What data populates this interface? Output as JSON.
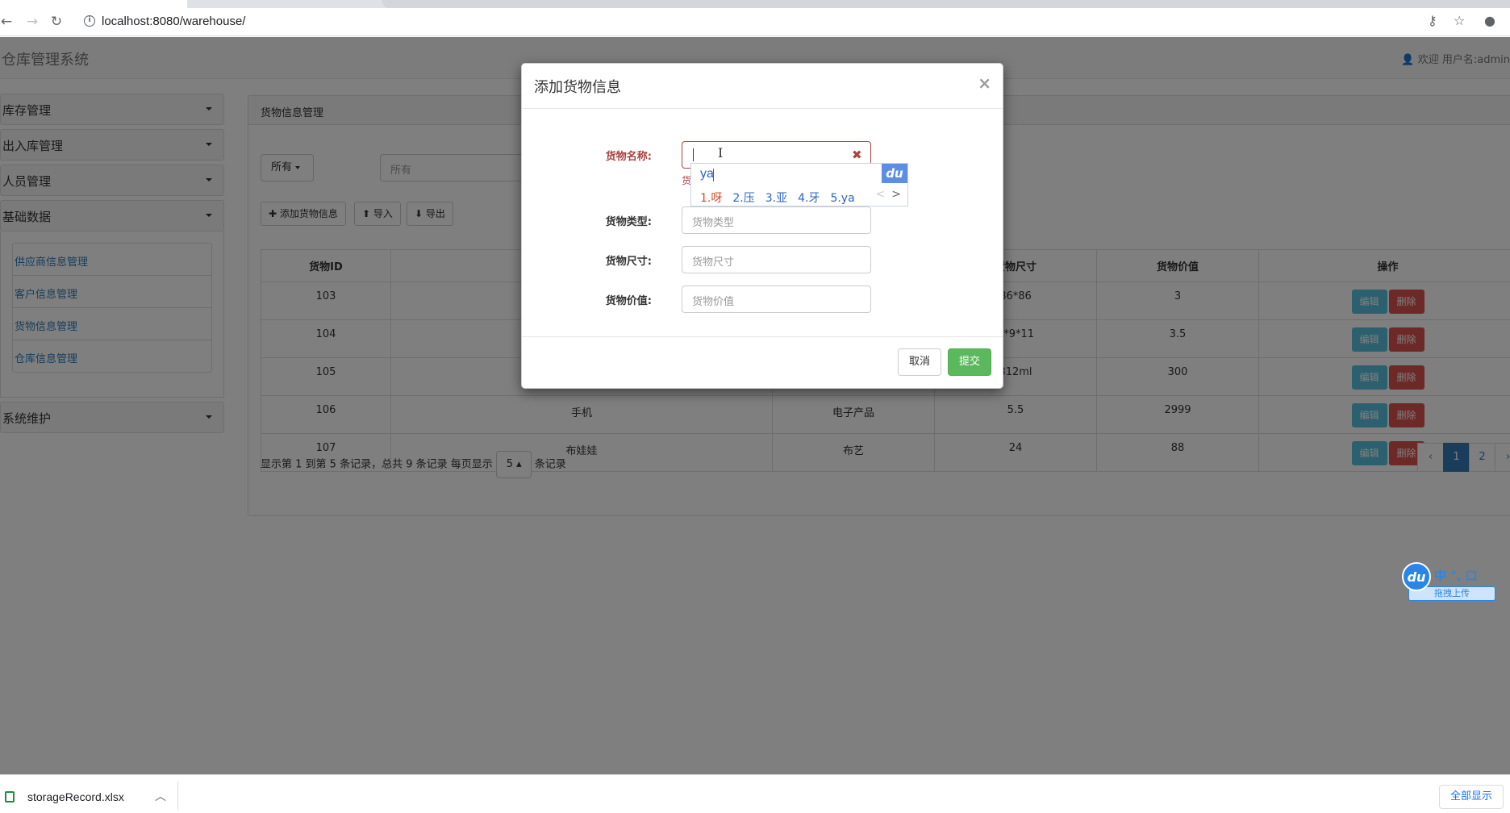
{
  "browser": {
    "url": "localhost:8080/warehouse/"
  },
  "app": {
    "brand": "仓库管理系统",
    "user_info": "欢迎  用户名:admin"
  },
  "sidebar": {
    "menus": [
      {
        "label": "库存管理"
      },
      {
        "label": "出入库管理"
      },
      {
        "label": "人员管理"
      },
      {
        "label": "基础数据",
        "expanded": true
      }
    ],
    "submenu": [
      {
        "label": "供应商信息管理"
      },
      {
        "label": "客户信息管理"
      },
      {
        "label": "货物信息管理"
      },
      {
        "label": "仓库信息管理"
      }
    ],
    "bottom_menu": {
      "label": "系统维护"
    }
  },
  "main": {
    "heading": "货物信息管理",
    "filter_label": "所有",
    "filter_placeholder": "所有",
    "add_button": "添加货物信息",
    "import_button": "导入",
    "export_button": "导出",
    "table": {
      "headers": [
        "货物ID",
        "",
        "",
        "货物尺寸",
        "货物价值",
        "操作"
      ],
      "rows": [
        {
          "id": "103",
          "name": "",
          "type": "",
          "size": "86*86",
          "value": "3"
        },
        {
          "id": "104",
          "name": "",
          "type": "",
          "size": "9*9*11",
          "value": "3.5"
        },
        {
          "id": "105",
          "name": "",
          "type": "",
          "size": "312ml",
          "value": "300"
        },
        {
          "id": "106",
          "name": "手机",
          "type": "电子产品",
          "size": "5.5",
          "value": "2999"
        },
        {
          "id": "107",
          "name": "布娃娃",
          "type": "布艺",
          "size": "24",
          "value": "88"
        }
      ],
      "edit_label": "编辑",
      "delete_label": "删除"
    },
    "pager": {
      "summary": "显示第 1 到第 5 条记录，总共 9 条记录 每页显示",
      "page_size": "5",
      "suffix": "条记录",
      "prev": "‹",
      "pages": [
        "1",
        "2"
      ],
      "current_page": "1",
      "next": "›"
    }
  },
  "modal": {
    "title": "添加货物信息",
    "close": "×",
    "fields": [
      {
        "label": "货物名称:",
        "value": "",
        "placeholder": "",
        "error": true
      },
      {
        "label": "货物类型:",
        "placeholder": "货物类型"
      },
      {
        "label": "货物尺寸:",
        "placeholder": "货物尺寸"
      },
      {
        "label": "货物价值:",
        "placeholder": "货物价值"
      }
    ],
    "help_text": "货",
    "cancel": "取消",
    "submit": "提交"
  },
  "ime": {
    "pinyin": "ya",
    "candidates": [
      "1.呀",
      "2.压",
      "3.亚",
      "4.牙",
      "5.ya"
    ],
    "logo": "du",
    "toolbar_items": "中 °, 口 ",
    "upload_label": "拖拽上传"
  },
  "downloads": {
    "file_name": "storageRecord.xlsx",
    "show_all": "全部显示"
  },
  "colors": {
    "primary": "#337ab7",
    "success": "#5cb85c",
    "danger": "#d9534f",
    "info": "#5bc0de",
    "error": "#a94442"
  }
}
